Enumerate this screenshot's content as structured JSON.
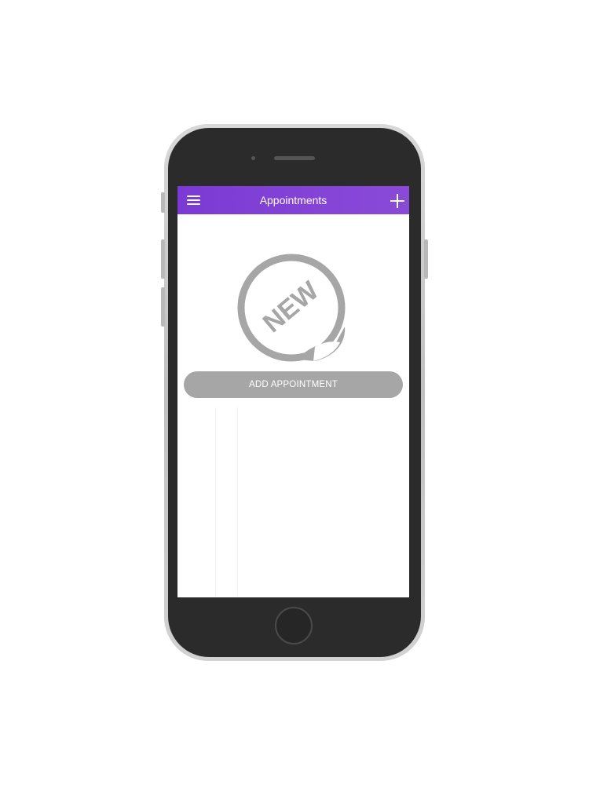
{
  "app_bar": {
    "title": "Appointments",
    "menu_icon": "hamburger-menu-icon",
    "add_icon": "plus-icon",
    "color": "#7b3ad4"
  },
  "empty_state": {
    "sticker_icon": "new-sticker-icon",
    "sticker_text": "NEW",
    "sticker_color": "#a6a6a6"
  },
  "actions": {
    "add_appointment_label": "ADD APPOINTMENT",
    "button_color": "#a6a6a6"
  }
}
